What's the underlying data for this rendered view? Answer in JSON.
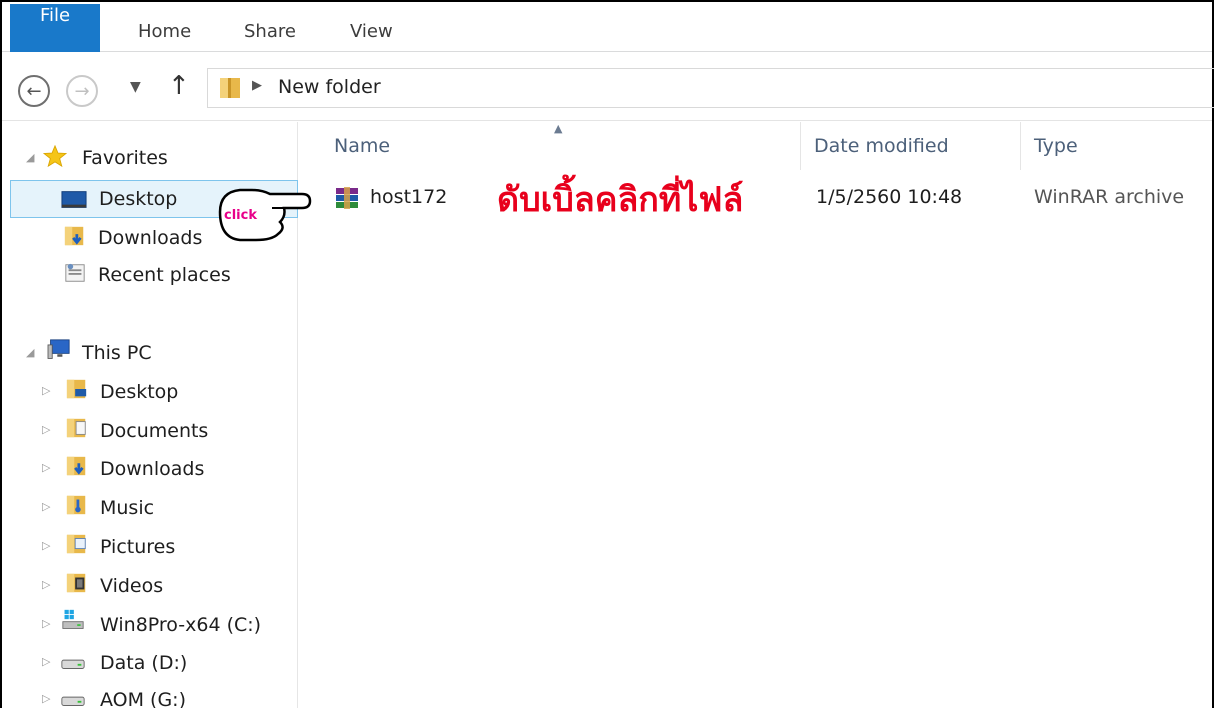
{
  "ribbon": {
    "tabs": [
      "File",
      "Home",
      "Share",
      "View"
    ]
  },
  "address": {
    "path": "New folder",
    "back_icon": "back-arrow-icon",
    "forward_icon": "forward-arrow-icon",
    "up_icon": "up-arrow-icon"
  },
  "sidebar": {
    "favorites": {
      "label": "Favorites",
      "items": [
        {
          "label": "Desktop",
          "icon": "desktop-icon",
          "selected": true
        },
        {
          "label": "Downloads",
          "icon": "downloads-folder-icon"
        },
        {
          "label": "Recent places",
          "icon": "recent-places-icon"
        }
      ]
    },
    "this_pc": {
      "label": "This PC",
      "items": [
        {
          "label": "Desktop",
          "icon": "desktop-folder-icon"
        },
        {
          "label": "Documents",
          "icon": "documents-folder-icon"
        },
        {
          "label": "Downloads",
          "icon": "downloads-folder-icon"
        },
        {
          "label": "Music",
          "icon": "music-folder-icon"
        },
        {
          "label": "Pictures",
          "icon": "pictures-folder-icon"
        },
        {
          "label": "Videos",
          "icon": "videos-folder-icon"
        },
        {
          "label": "Win8Pro-x64 (C:)",
          "icon": "windows-drive-icon"
        },
        {
          "label": "Data (D:)",
          "icon": "drive-icon"
        },
        {
          "label": "AOM (G:)",
          "icon": "drive-icon"
        }
      ]
    }
  },
  "columns": {
    "name": "Name",
    "date_modified": "Date modified",
    "type": "Type"
  },
  "files": [
    {
      "name": "host172",
      "date_modified": "1/5/2560 10:48",
      "type": "WinRAR archive",
      "icon": "winrar-archive-icon"
    }
  ],
  "annotation": {
    "text": "ดับเบิ้ลคลิกที่ไฟล์",
    "cursor_label": "click",
    "color": "#e8001c"
  },
  "colors": {
    "file_tab": "#1979ca",
    "selection_bg": "#e5f3fb",
    "selection_border": "#7ec4ec",
    "header_text": "#4c607a"
  }
}
